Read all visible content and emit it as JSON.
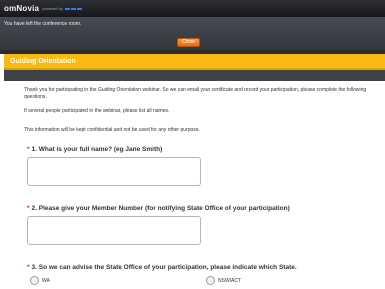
{
  "topbar": {
    "brand": "omNovia",
    "brand_sub": "powered by"
  },
  "notice": {
    "text": "You have left the conference room.",
    "close_label": "Close"
  },
  "header": {
    "title": "Guiding Orientation"
  },
  "intro": {
    "p1": "Thank you for participating in the Guiding Orientation webinar. So we can email your certificate and record your participation, please complete the following questions.",
    "p2": "If several people participated in the webinar, please list all names.",
    "p3": "This information will be kept confidential and not be used for any other purpose."
  },
  "questions": [
    {
      "required_mark": "*",
      "label": "1. What is your full name? (eg Jane Smith)",
      "value": ""
    },
    {
      "required_mark": "*",
      "label": "2. Please give your Member Number (for notifying State Office of your participation)",
      "value": ""
    },
    {
      "required_mark": "*",
      "label": "3. So we can advise the State Office of your participation, please indicate which State.",
      "options": [
        "WA",
        "NSW/ACT"
      ]
    }
  ],
  "colors": {
    "accent": "#f9bb12",
    "close_button": "#f27a1a",
    "required": "#e8211a",
    "dark_bar": "#2e3035"
  }
}
